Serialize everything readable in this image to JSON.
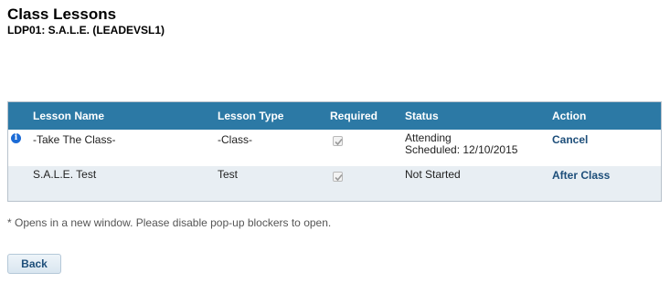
{
  "page": {
    "title": "Class Lessons",
    "subtitle": "LDP01: S.A.L.E. (LEADEVSL1)"
  },
  "table": {
    "columns": [
      "Lesson Name",
      "Lesson Type",
      "Required",
      "Status",
      "Action"
    ],
    "rows": [
      {
        "info_icon": "info-icon",
        "lesson_name": "-Take The Class-",
        "lesson_type": "-Class-",
        "required": true,
        "status_line1": "Attending",
        "status_line2": "Scheduled: 12/10/2015",
        "action": "Cancel"
      },
      {
        "lesson_name": "S.A.L.E. Test",
        "lesson_type": "Test",
        "required": true,
        "status_line1": "Not Started",
        "action": "After Class"
      }
    ]
  },
  "footnote": "* Opens in a new window. Please disable pop-up blockers to open.",
  "buttons": {
    "back_label": "Back"
  },
  "colors": {
    "header_bg": "#2c79a5",
    "alt_row_bg": "#e8eef3",
    "link": "#1d4e7a"
  }
}
